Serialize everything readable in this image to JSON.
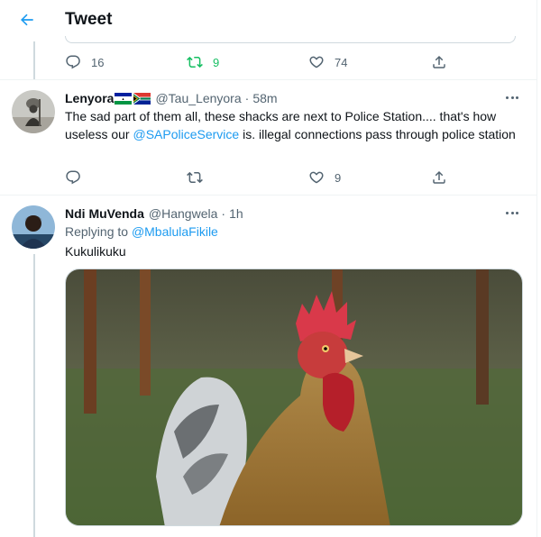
{
  "header": {
    "title": "Tweet"
  },
  "top_actions": {
    "replies": "16",
    "retweets": "9",
    "likes": "74"
  },
  "tweets": [
    {
      "display_name": "Lenyora",
      "handle": "@Tau_Lenyora",
      "separator": "·",
      "time": "58m",
      "text_before": "The sad part of them all, these shacks are next to Police Station.... that's how useless our ",
      "mention": "@SAPoliceService",
      "text_after": " is. illegal connections pass through police station",
      "replies": "",
      "retweets": "",
      "likes": "9"
    },
    {
      "display_name": "Ndi MuVenda",
      "handle": "@Hangwela",
      "separator": "·",
      "time": "1h",
      "replying_prefix": "Replying to",
      "replying_to": "@MbalulaFikile",
      "text": "Kukulikuku"
    }
  ],
  "colors": {
    "accent": "#1d9bf0",
    "retweet": "#17bf63",
    "muted": "#536471"
  }
}
